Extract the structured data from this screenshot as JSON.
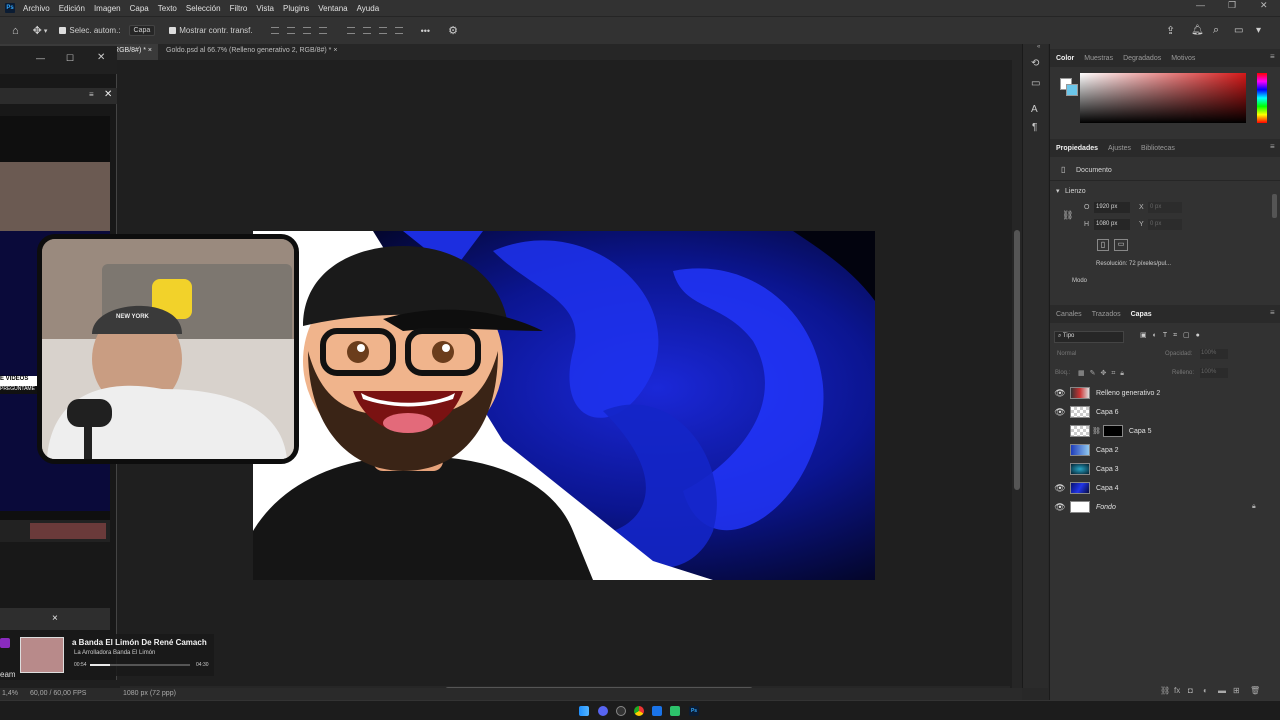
{
  "menu": {
    "app_icon": "Ps",
    "items": [
      "Archivo",
      "Edición",
      "Imagen",
      "Capa",
      "Texto",
      "Selección",
      "Filtro",
      "Vista",
      "Plugins",
      "Ventana",
      "Ayuda"
    ]
  },
  "options": {
    "auto_select_label": "Selec. autom.:",
    "auto_select_target": "Capa",
    "show_transform_label": "Mostrar contr. transf.",
    "more_label": "•••"
  },
  "tabs": [
    {
      "label": "...(RGB/8#) *",
      "active": true
    },
    {
      "label": "Goldo.psd al 66.7% (Relleno generativo 2, RGB/8#) *",
      "active": false
    }
  ],
  "color_panel": {
    "tabs": [
      "Color",
      "Muestras",
      "Degradados",
      "Motivos"
    ],
    "accent_colors": {
      "foreground": "#ffffff",
      "background": "#6bc6ea",
      "hue": "#d41818"
    }
  },
  "properties": {
    "tabs": [
      "Propiedades",
      "Ajustes",
      "Bibliotecas"
    ],
    "document_label": "Documento",
    "section": "Lienzo",
    "width_label": "O",
    "width_value": "1920 px",
    "height_label": "H",
    "height_value": "1080 px",
    "x_label": "X",
    "x_value": "0 px",
    "y_label": "Y",
    "y_value": "0 px",
    "resolution": "Resolución: 72 píxeles/pul...",
    "mode_label": "Modo"
  },
  "layers_panel": {
    "tabs": [
      "Canales",
      "Trazados",
      "Capas"
    ],
    "filter": "Tipo",
    "blend_mode": "Normal",
    "opacity_label": "Opacidad:",
    "opacity_value": "100%",
    "lock_label": "Bloq.:",
    "fill_label": "Relleno:",
    "fill_value": "100%",
    "layers": [
      {
        "name": "Relleno generativo 2",
        "visible": true
      },
      {
        "name": "Capa 6",
        "visible": true
      },
      {
        "name": "Capa 5",
        "visible": false
      },
      {
        "name": "Capa 2",
        "visible": false
      },
      {
        "name": "Capa 3",
        "visible": false
      },
      {
        "name": "Capa 4",
        "visible": true
      },
      {
        "name": "Fondo",
        "visible": true
      }
    ]
  },
  "left_window": {
    "overlay_text_1": "E VIDEOS",
    "overlay_text_2": "PREGUNTAME",
    "close_label": "×",
    "cap_text": "NEW YORK"
  },
  "media": {
    "title": "a Banda El Limón De René Camach",
    "artist": "La Arrolladora Banda El Limón",
    "elapsed": "00:54",
    "duration": "04:30",
    "side_text": "eam"
  },
  "status": {
    "left": "1,4%",
    "fps": "60,00 / 60,00 FPS",
    "doc_info": "1080 px (72 ppp)"
  }
}
